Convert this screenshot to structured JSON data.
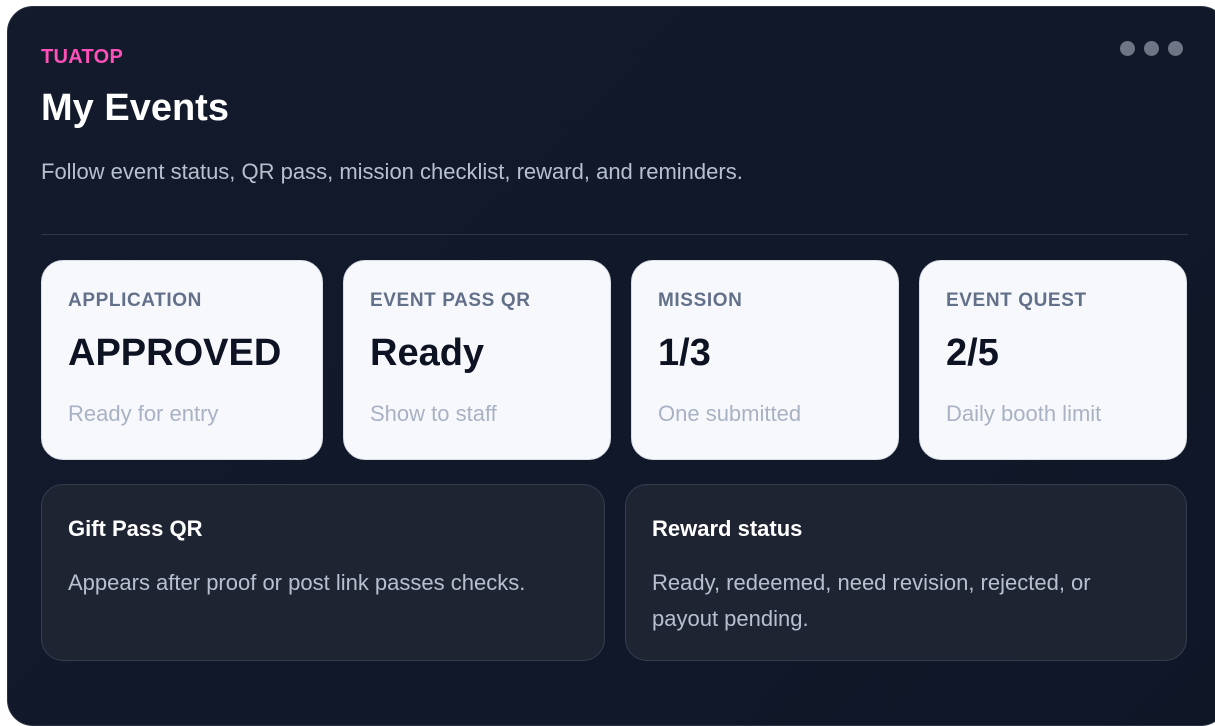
{
  "header": {
    "brand": "TUATOP",
    "title": "My Events",
    "subtitle": "Follow event status, QR pass, mission checklist, reward, and reminders."
  },
  "stats": [
    {
      "label": "APPLICATION",
      "value": "APPROVED",
      "note": "Ready for entry"
    },
    {
      "label": "EVENT PASS QR",
      "value": "Ready",
      "note": "Show to staff"
    },
    {
      "label": "MISSION",
      "value": "1/3",
      "note": "One submitted"
    },
    {
      "label": "EVENT QUEST",
      "value": "2/5",
      "note": "Daily booth limit"
    }
  ],
  "info_cards": [
    {
      "title": "Gift Pass QR",
      "body": "Appears after proof or post link passes checks."
    },
    {
      "title": "Reward status",
      "body": "Ready, redeemed, need revision, rejected, or payout pending."
    }
  ],
  "icons": {
    "menu": "more-dots-icon"
  },
  "colors": {
    "accent": "#ff4fb8",
    "panel_background": "#111a2b",
    "card_background": "#f6f8fb"
  }
}
